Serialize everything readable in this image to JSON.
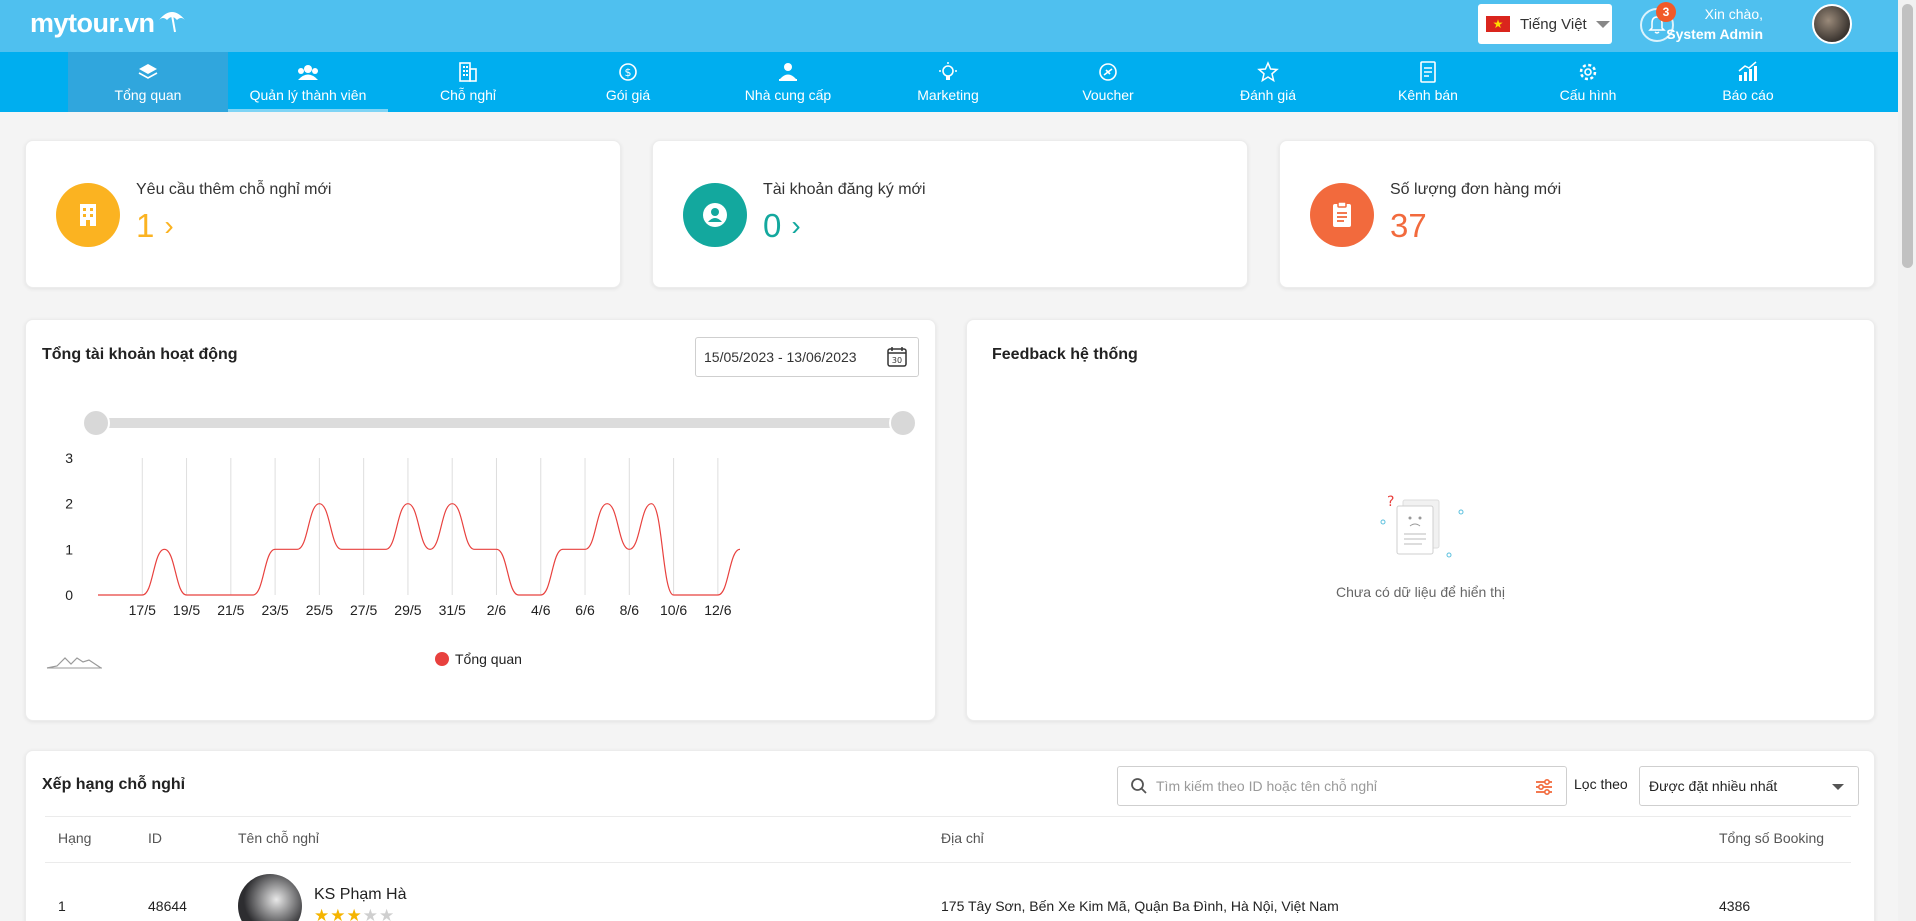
{
  "header": {
    "logo": "mytour.vn",
    "language": "Tiếng Việt",
    "notification_count": "3",
    "greeting": "Xin chào,",
    "user_name": "System Admin"
  },
  "nav": {
    "items": [
      {
        "label": "Tổng quan",
        "icon": "layers-icon"
      },
      {
        "label": "Quản lý thành viên",
        "icon": "users-icon"
      },
      {
        "label": "Chỗ nghỉ",
        "icon": "building-icon"
      },
      {
        "label": "Gói giá",
        "icon": "dollar-icon"
      },
      {
        "label": "Nhà cung cấp",
        "icon": "supplier-icon"
      },
      {
        "label": "Marketing",
        "icon": "bulb-icon"
      },
      {
        "label": "Voucher",
        "icon": "voucher-icon"
      },
      {
        "label": "Đánh giá",
        "icon": "star-icon"
      },
      {
        "label": "Kênh bán",
        "icon": "checklist-icon"
      },
      {
        "label": "Cấu hình",
        "icon": "gear-icon"
      },
      {
        "label": "Báo cáo",
        "icon": "report-icon"
      }
    ],
    "active_index": 0
  },
  "stats": [
    {
      "label": "Yêu cầu thêm chỗ nghỉ mới",
      "value": "1",
      "color": "#fbb321",
      "icon": "hotel-icon"
    },
    {
      "label": "Tài khoản đăng ký mới",
      "value": "0",
      "color": "#13a89e",
      "icon": "user-icon"
    },
    {
      "label": "Số lượng đơn hàng mới",
      "value": "37",
      "color": "#f26a3d",
      "icon": "clipboard-icon"
    }
  ],
  "activity": {
    "title": "Tổng tài khoản hoạt động",
    "date_range": "15/05/2023 - 13/06/2023",
    "calendar_day": "30"
  },
  "chart_data": {
    "type": "line",
    "title": "Tổng tài khoản hoạt động",
    "x": [
      "15/5",
      "16/5",
      "17/5",
      "18/5",
      "19/5",
      "20/5",
      "21/5",
      "22/5",
      "23/5",
      "24/5",
      "25/5",
      "26/5",
      "27/5",
      "28/5",
      "29/5",
      "30/5",
      "31/5",
      "1/6",
      "2/6",
      "3/6",
      "4/6",
      "5/6",
      "6/6",
      "7/6",
      "8/6",
      "9/6",
      "10/6",
      "11/6",
      "12/6",
      "13/6"
    ],
    "tick_labels": [
      "17/5",
      "19/5",
      "21/5",
      "23/5",
      "25/5",
      "27/5",
      "29/5",
      "31/5",
      "2/6",
      "4/6",
      "6/6",
      "8/6",
      "10/6",
      "12/6"
    ],
    "y_ticks": [
      "0",
      "1",
      "2",
      "3"
    ],
    "series": [
      {
        "name": "Tổng quan",
        "color": "#e8413e",
        "values": [
          0,
          0,
          0,
          1,
          0,
          0,
          0,
          0,
          1,
          1,
          2,
          1,
          1,
          1,
          2,
          1,
          2,
          1,
          1,
          0,
          0,
          1,
          1,
          2,
          1,
          2,
          0,
          0,
          0,
          1
        ]
      }
    ],
    "ylim": [
      0,
      3
    ],
    "grid": "vertical",
    "legend": "bottom-center"
  },
  "feedback": {
    "title": "Feedback hệ thống",
    "empty_text": "Chưa có dữ liệu để hiển thị"
  },
  "ranking": {
    "title": "Xếp hạng chỗ nghỉ",
    "search_placeholder": "Tìm kiếm theo ID hoặc tên chỗ nghỉ",
    "filter_label": "Lọc theo",
    "filter_value": "Được đặt nhiều nhất",
    "columns": [
      "Hạng",
      "ID",
      "Tên chỗ nghỉ",
      "Địa chỉ",
      "Tổng số Booking"
    ],
    "rows": [
      {
        "rank": "1",
        "id": "48644",
        "name": "KS Phạm Hà",
        "stars": 3,
        "address": "175 Tây Sơn, Bến Xe Kim Mã, Quận Ba Đình, Hà Nội, Việt Nam",
        "bookings": "4386"
      }
    ]
  }
}
